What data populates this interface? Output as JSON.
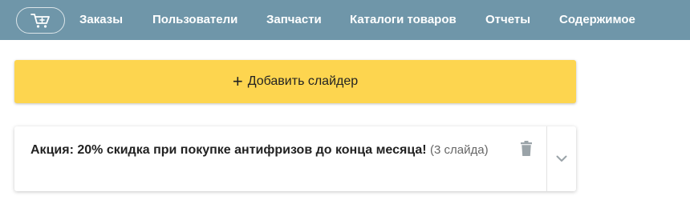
{
  "nav": {
    "logo_icon": "cart-plus-icon",
    "items": [
      {
        "label": "Заказы"
      },
      {
        "label": "Пользователи"
      },
      {
        "label": "Запчасти"
      },
      {
        "label": "Каталоги товаров"
      },
      {
        "label": "Отчеты"
      },
      {
        "label": "Содержимое"
      }
    ]
  },
  "add_slider": {
    "icon": "plus-icon",
    "label": "Добавить слайдер"
  },
  "slider_card": {
    "title": "Акция: 20% скидка при покупке антифризов до конца месяца!",
    "count": "(3 слайда)",
    "delete_icon": "trash-icon",
    "expand_icon": "chevron-down-icon"
  },
  "colors": {
    "nav_bg": "#6f96a9",
    "button_bg": "#fdd54f",
    "icon_gray": "#9aa3a8"
  }
}
